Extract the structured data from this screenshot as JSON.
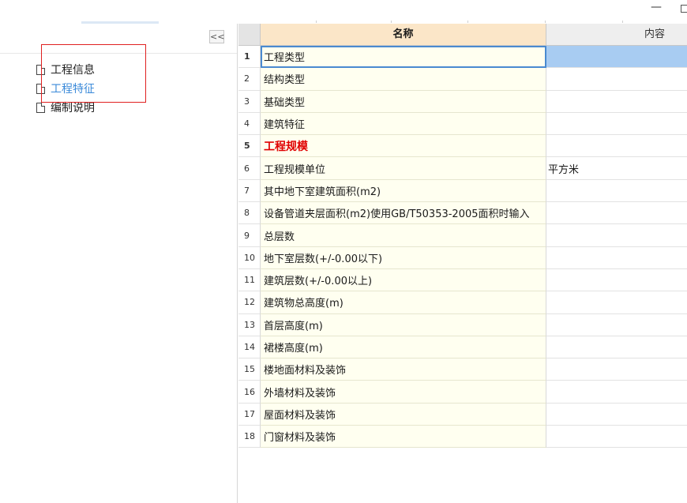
{
  "window": {
    "minimize_label": "—"
  },
  "left_panel": {
    "collapse_label": "<<",
    "tree": [
      {
        "label": "工程信息",
        "active": false
      },
      {
        "label": "工程特征",
        "active": true
      },
      {
        "label": "编制说明",
        "active": false
      }
    ]
  },
  "grid": {
    "columns": {
      "name": "名称",
      "content": "内容"
    },
    "rows": [
      {
        "num": "1",
        "name": "工程类型",
        "content": ""
      },
      {
        "num": "2",
        "name": "结构类型",
        "content": ""
      },
      {
        "num": "3",
        "name": "基础类型",
        "content": ""
      },
      {
        "num": "4",
        "name": "建筑特征",
        "content": ""
      },
      {
        "num": "5",
        "name": "工程规模",
        "content": ""
      },
      {
        "num": "6",
        "name": "工程规模单位",
        "content": "平方米"
      },
      {
        "num": "7",
        "name": "其中地下室建筑面积(m2)",
        "content": ""
      },
      {
        "num": "8",
        "name": "设备管道夹层面积(m2)使用GB/T50353-2005面积时输入",
        "content": ""
      },
      {
        "num": "9",
        "name": "总层数",
        "content": ""
      },
      {
        "num": "10",
        "name": "地下室层数(+/-0.00以下)",
        "content": ""
      },
      {
        "num": "11",
        "name": "建筑层数(+/-0.00以上)",
        "content": ""
      },
      {
        "num": "12",
        "name": "建筑物总高度(m)",
        "content": ""
      },
      {
        "num": "13",
        "name": "首层高度(m)",
        "content": ""
      },
      {
        "num": "14",
        "name": "裙楼高度(m)",
        "content": ""
      },
      {
        "num": "15",
        "name": "楼地面材料及装饰",
        "content": ""
      },
      {
        "num": "16",
        "name": "外墙材料及装饰",
        "content": ""
      },
      {
        "num": "17",
        "name": "屋面材料及装饰",
        "content": ""
      },
      {
        "num": "18",
        "name": "门窗材料及装饰",
        "content": ""
      }
    ]
  },
  "colors": {
    "highlight_box": "#e02020",
    "active_link": "#3b8ad9",
    "header_name_bg": "#fbe6c8",
    "name_cell_bg": "#fffff0",
    "selected_cell_bg": "#a8ccf2",
    "bold_row_text": "#e00000"
  }
}
